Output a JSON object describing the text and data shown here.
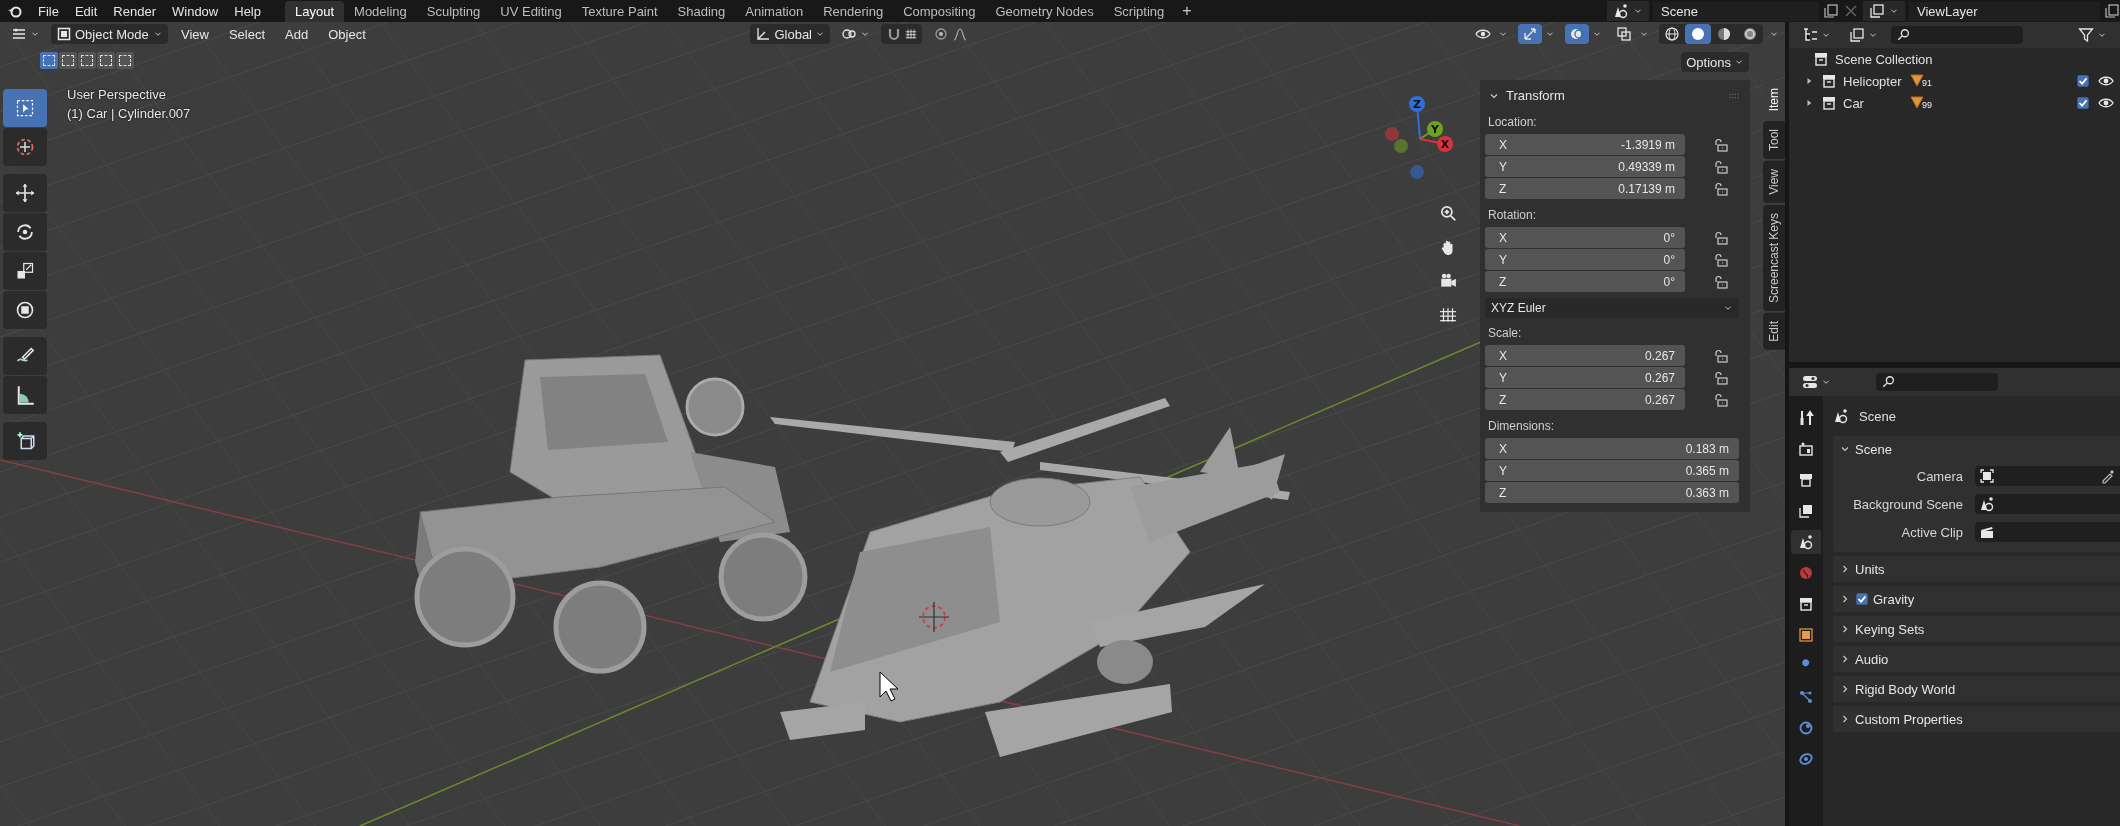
{
  "top_menu": [
    "File",
    "Edit",
    "Render",
    "Window",
    "Help"
  ],
  "workspace_tabs": [
    {
      "label": "Layout",
      "selected": true
    },
    {
      "label": "Modeling",
      "selected": false
    },
    {
      "label": "Sculpting",
      "selected": false
    },
    {
      "label": "UV Editing",
      "selected": false
    },
    {
      "label": "Texture Paint",
      "selected": false
    },
    {
      "label": "Shading",
      "selected": false
    },
    {
      "label": "Animation",
      "selected": false
    },
    {
      "label": "Rendering",
      "selected": false
    },
    {
      "label": "Compositing",
      "selected": false
    },
    {
      "label": "Geometry Nodes",
      "selected": false
    },
    {
      "label": "Scripting",
      "selected": false
    }
  ],
  "add_workspace": "+",
  "scene": "Scene",
  "view_layer": "ViewLayer",
  "viewport": {
    "header": {
      "mode": "Object Mode",
      "menus": [
        "View",
        "Select",
        "Add",
        "Object"
      ],
      "orientation": "Global",
      "select_modes": [
        {
          "selected": true
        },
        {
          "selected": false
        },
        {
          "selected": false
        },
        {
          "selected": false
        },
        {
          "selected": false
        }
      ],
      "toggles": [
        {
          "kind": "visibility",
          "on": false
        },
        {
          "kind": "gizmo",
          "on": true
        },
        {
          "kind": "overlay",
          "on": true
        },
        {
          "kind": "xray",
          "on": false
        }
      ],
      "shading_modes": [
        {
          "kind": "wireframe",
          "selected": false
        },
        {
          "kind": "solid",
          "selected": true
        },
        {
          "kind": "material",
          "selected": false
        },
        {
          "kind": "rendered",
          "selected": false
        }
      ],
      "options": "Options"
    },
    "overlay_text": [
      "User Perspective",
      "(1) Car | Cylinder.007"
    ],
    "tools": [
      {
        "kind": "select",
        "selected": true
      },
      {
        "kind": "cursor",
        "selected": false
      },
      {
        "kind": "move",
        "selected": false
      },
      {
        "kind": "rotate",
        "selected": false
      },
      {
        "kind": "scale",
        "selected": false
      },
      {
        "kind": "transform",
        "selected": false
      },
      {
        "kind": "annotate",
        "selected": false
      },
      {
        "kind": "measure",
        "selected": false
      },
      {
        "kind": "add-cube",
        "selected": false
      }
    ],
    "gizmo_axes": [
      {
        "label": "Z",
        "color": "#2f6fd6"
      },
      {
        "label": "Y",
        "color": "#6ea11f"
      },
      {
        "label": "X",
        "color": "#d8323c"
      }
    ],
    "nav_buttons": [
      {
        "kind": "zoom"
      },
      {
        "kind": "hand"
      },
      {
        "kind": "camera"
      },
      {
        "kind": "grid"
      }
    ],
    "sidebar": {
      "title": "Transform",
      "sections": [
        {
          "label": "Location:",
          "rows": [
            {
              "axis": "X",
              "value": "-1.3919 m",
              "locked": false
            },
            {
              "axis": "Y",
              "value": "0.49339 m",
              "locked": false
            },
            {
              "axis": "Z",
              "value": "0.17139 m",
              "locked": false
            }
          ]
        },
        {
          "label": "Rotation:",
          "rows": [
            {
              "axis": "X",
              "value": "0°",
              "locked": false
            },
            {
              "axis": "Y",
              "value": "0°",
              "locked": false
            },
            {
              "axis": "Z",
              "value": "0°",
              "locked": false
            }
          ],
          "mode": "XYZ Euler"
        },
        {
          "label": "Scale:",
          "rows": [
            {
              "axis": "X",
              "value": "0.267",
              "locked": false
            },
            {
              "axis": "Y",
              "value": "0.267",
              "locked": false
            },
            {
              "axis": "Z",
              "value": "0.267",
              "locked": false
            }
          ]
        },
        {
          "label": "Dimensions:",
          "rows": [
            {
              "axis": "X",
              "value": "0.183 m"
            },
            {
              "axis": "Y",
              "value": "0.365 m"
            },
            {
              "axis": "Z",
              "value": "0.363 m"
            }
          ]
        }
      ],
      "tabs": [
        {
          "label": "Item",
          "selected": true
        },
        {
          "label": "Tool",
          "selected": false
        },
        {
          "label": "View",
          "selected": false
        },
        {
          "label": "Screencast Keys",
          "selected": false
        },
        {
          "label": "Edit",
          "selected": false
        }
      ]
    }
  },
  "outliner": {
    "root": "Scene Collection",
    "children": [
      {
        "label": "Helicopter",
        "badge": "91",
        "expanded": false,
        "checked": true,
        "visible": true
      },
      {
        "label": "Car",
        "badge": "99",
        "expanded": false,
        "checked": true,
        "visible": true
      }
    ]
  },
  "properties": {
    "tabs": [
      {
        "kind": "tool",
        "selected": false
      },
      {
        "kind": "render",
        "selected": false
      },
      {
        "kind": "output",
        "selected": false
      },
      {
        "kind": "view-layer",
        "selected": false
      },
      {
        "kind": "scene",
        "selected": true
      },
      {
        "kind": "world",
        "selected": false
      },
      {
        "kind": "collection",
        "selected": false
      },
      {
        "kind": "object",
        "selected": false
      },
      {
        "kind": "modifiers",
        "selected": false
      },
      {
        "kind": "particles",
        "selected": false
      },
      {
        "kind": "physics",
        "selected": false
      },
      {
        "kind": "constraints",
        "selected": false
      }
    ],
    "breadcrumb": "Scene",
    "panels": [
      {
        "title": "Scene",
        "expanded": true,
        "fields": [
          {
            "label": "Camera",
            "kind": "camera"
          },
          {
            "label": "Background Scene",
            "kind": "scene"
          },
          {
            "label": "Active Clip",
            "kind": "clip"
          }
        ]
      },
      {
        "title": "Units",
        "expanded": false
      },
      {
        "title": "Gravity",
        "expanded": false,
        "checked": true
      },
      {
        "title": "Keying Sets",
        "expanded": false
      },
      {
        "title": "Audio",
        "expanded": false
      },
      {
        "title": "Rigid Body World",
        "expanded": false
      },
      {
        "title": "Custom Properties",
        "expanded": false
      }
    ]
  }
}
